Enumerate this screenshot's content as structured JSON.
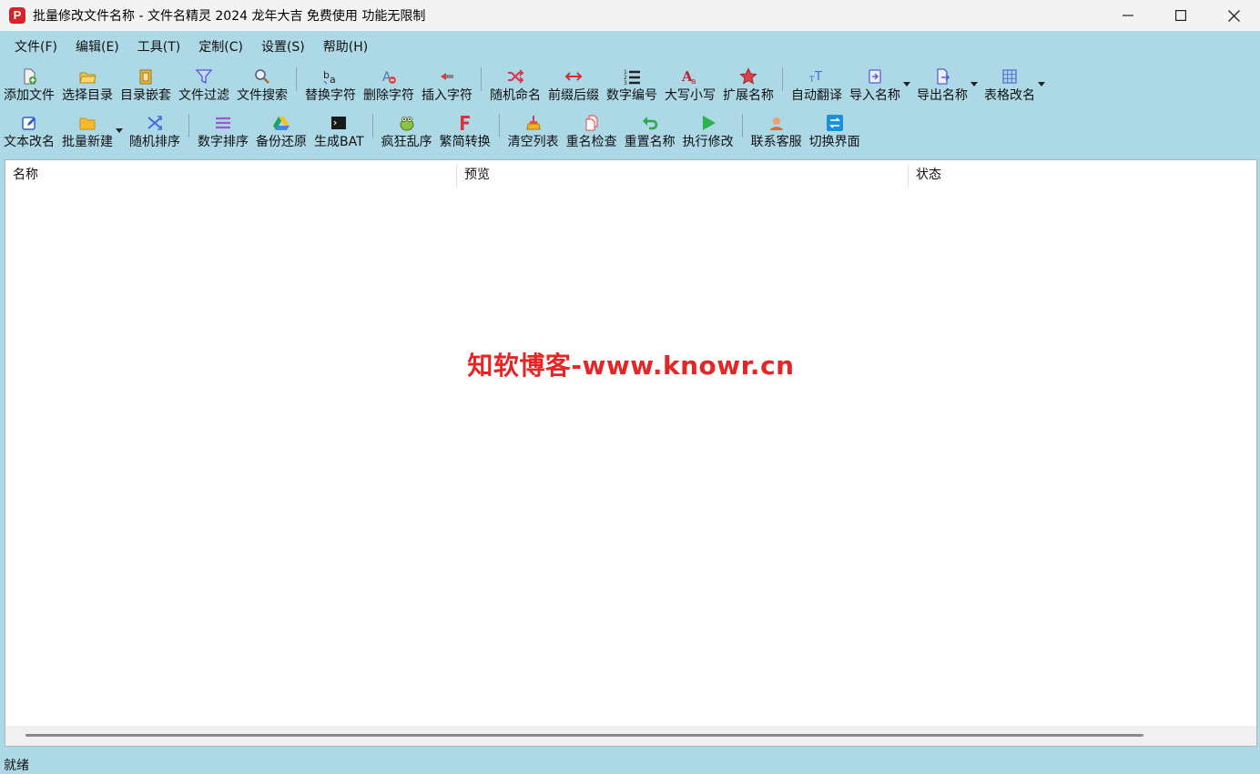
{
  "window": {
    "app_icon_letter": "P",
    "title": "批量修改文件名称 - 文件名精灵 2024 龙年大吉 免费使用 功能无限制"
  },
  "menu": [
    "文件(F)",
    "编辑(E)",
    "工具(T)",
    "定制(C)",
    "设置(S)",
    "帮助(H)"
  ],
  "toolbar1": [
    {
      "label": "添加文件",
      "icon": "add-file-icon"
    },
    {
      "label": "选择目录",
      "icon": "folder-open-icon"
    },
    {
      "label": "目录嵌套",
      "icon": "nested-folder-icon"
    },
    {
      "label": "文件过滤",
      "icon": "filter-icon"
    },
    {
      "label": "文件搜索",
      "icon": "search-icon"
    },
    {
      "label": "替换字符",
      "icon": "replace-chars-icon"
    },
    {
      "label": "删除字符",
      "icon": "delete-chars-icon"
    },
    {
      "label": "插入字符",
      "icon": "insert-chars-icon"
    },
    {
      "label": "随机命名",
      "icon": "shuffle-icon"
    },
    {
      "label": "前缀后缀",
      "icon": "prefix-suffix-icon"
    },
    {
      "label": "数字编号",
      "icon": "numbered-list-icon"
    },
    {
      "label": "大写小写",
      "icon": "letter-case-icon"
    },
    {
      "label": "扩展名称",
      "icon": "star-icon"
    },
    {
      "label": "自动翻译",
      "icon": "translate-icon"
    },
    {
      "label": "导入名称",
      "icon": "import-icon"
    },
    {
      "label": "导出名称",
      "icon": "export-icon"
    },
    {
      "label": "表格改名",
      "icon": "table-icon"
    }
  ],
  "toolbar2": [
    {
      "label": "文本改名",
      "icon": "edit-icon"
    },
    {
      "label": "批量新建",
      "icon": "new-folder-icon"
    },
    {
      "label": "随机排序",
      "icon": "random-sort-icon"
    },
    {
      "label": "数字排序",
      "icon": "number-sort-icon"
    },
    {
      "label": "备份还原",
      "icon": "backup-drive-icon"
    },
    {
      "label": "生成BAT",
      "icon": "terminal-icon"
    },
    {
      "label": "疯狂乱序",
      "icon": "frog-icon"
    },
    {
      "label": "繁简转换",
      "icon": "font-f-icon"
    },
    {
      "label": "清空列表",
      "icon": "broom-icon"
    },
    {
      "label": "重名检查",
      "icon": "duplicate-icon"
    },
    {
      "label": "重置名称",
      "icon": "undo-icon"
    },
    {
      "label": "执行修改",
      "icon": "play-icon"
    },
    {
      "label": "联系客服",
      "icon": "support-icon"
    },
    {
      "label": "切换界面",
      "icon": "switch-icon"
    }
  ],
  "list": {
    "columns": [
      "名称",
      "预览",
      "状态"
    ]
  },
  "watermark": "知软博客-www.knowr.cn",
  "status": "就绪",
  "colors": {
    "background": "#add8e6",
    "watermark": "#e52626",
    "app_icon": "#d8232a"
  }
}
